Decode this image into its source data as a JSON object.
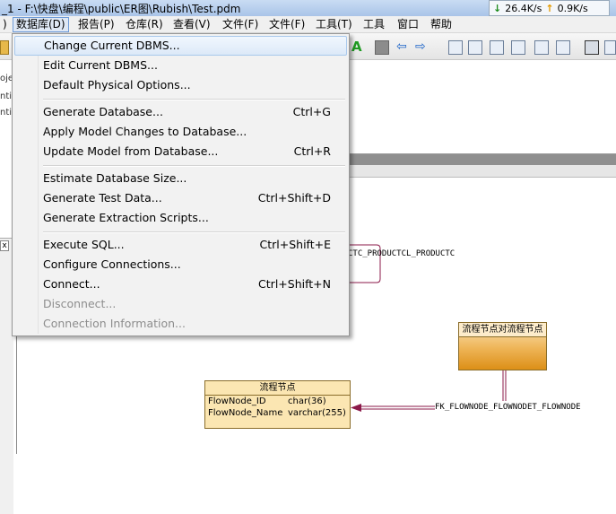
{
  "window": {
    "title": "_1 - F:\\快盘\\编程\\public\\ER图\\Rubish\\Test.pdm",
    "net_down": "26.4K/s",
    "net_up": "0.9K/s"
  },
  "menubar": [
    {
      "id": "m-left",
      "label": ")"
    },
    {
      "id": "m-db",
      "label": "数据库(D)"
    },
    {
      "id": "m-report",
      "label": "报告(P)"
    },
    {
      "id": "m-repo",
      "label": "仓库(R)"
    },
    {
      "id": "m-view",
      "label": "查看(V)"
    },
    {
      "id": "m-file1",
      "label": "文件(F)"
    },
    {
      "id": "m-file2",
      "label": "文件(F)"
    },
    {
      "id": "m-tools1",
      "label": "工具(T)"
    },
    {
      "id": "m-tools2",
      "label": "工具"
    },
    {
      "id": "m-window",
      "label": "窗口"
    },
    {
      "id": "m-help",
      "label": "帮助"
    }
  ],
  "left_panel": {
    "line1": "oje",
    "line2": "ntity",
    "line3": "ntity",
    "close": "x"
  },
  "database_menu": {
    "change_dbms": "Change Current DBMS...",
    "edit_dbms": "Edit Current DBMS...",
    "default_options": "Default Physical Options...",
    "generate_db": "Generate Database...",
    "generate_db_sc": "Ctrl+G",
    "apply_changes": "Apply Model Changes to Database...",
    "update_model": "Update Model from Database...",
    "update_model_sc": "Ctrl+R",
    "estimate_size": "Estimate Database Size...",
    "gen_test_data": "Generate Test Data...",
    "gen_test_data_sc": "Ctrl+Shift+D",
    "gen_extraction": "Generate Extraction Scripts...",
    "execute_sql": "Execute SQL...",
    "execute_sql_sc": "Ctrl+Shift+E",
    "configure_conn": "Configure Connections...",
    "connect": "Connect...",
    "connect_sc": "Ctrl+Shift+N",
    "disconnect": "Disconnect...",
    "conn_info": "Connection Information..."
  },
  "diagram": {
    "ref_label_top": "CTC_PRODUCTCL_PRODUCTC",
    "ref_label_bottom": "FK_FLOWNODE_FLOWNODET_FLOWNODE",
    "entity_flow": {
      "title": "流程节点",
      "rows": [
        {
          "name": "FlowNode_ID",
          "type": "char(36)"
        },
        {
          "name": "FlowNode_Name",
          "type": "varchar(255)"
        }
      ]
    },
    "entity_link": {
      "title": "流程节点对流程节点"
    }
  },
  "colors": {
    "menu_highlight": "#dce9f8",
    "entity_fill": "#fbe6b2",
    "entity_grad_end": "#dc8f17",
    "relation_line": "#8b1a4a"
  }
}
